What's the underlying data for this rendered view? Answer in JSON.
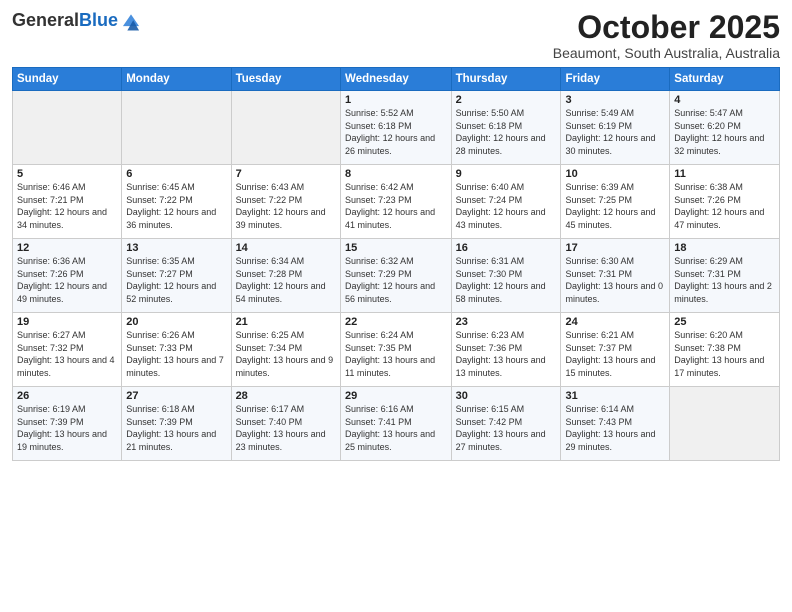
{
  "header": {
    "logo_general": "General",
    "logo_blue": "Blue",
    "month": "October 2025",
    "location": "Beaumont, South Australia, Australia"
  },
  "days_of_week": [
    "Sunday",
    "Monday",
    "Tuesday",
    "Wednesday",
    "Thursday",
    "Friday",
    "Saturday"
  ],
  "weeks": [
    [
      {
        "day": "",
        "sunrise": "",
        "sunset": "",
        "daylight": ""
      },
      {
        "day": "",
        "sunrise": "",
        "sunset": "",
        "daylight": ""
      },
      {
        "day": "",
        "sunrise": "",
        "sunset": "",
        "daylight": ""
      },
      {
        "day": "1",
        "sunrise": "Sunrise: 5:52 AM",
        "sunset": "Sunset: 6:18 PM",
        "daylight": "Daylight: 12 hours and 26 minutes."
      },
      {
        "day": "2",
        "sunrise": "Sunrise: 5:50 AM",
        "sunset": "Sunset: 6:18 PM",
        "daylight": "Daylight: 12 hours and 28 minutes."
      },
      {
        "day": "3",
        "sunrise": "Sunrise: 5:49 AM",
        "sunset": "Sunset: 6:19 PM",
        "daylight": "Daylight: 12 hours and 30 minutes."
      },
      {
        "day": "4",
        "sunrise": "Sunrise: 5:47 AM",
        "sunset": "Sunset: 6:20 PM",
        "daylight": "Daylight: 12 hours and 32 minutes."
      }
    ],
    [
      {
        "day": "5",
        "sunrise": "Sunrise: 6:46 AM",
        "sunset": "Sunset: 7:21 PM",
        "daylight": "Daylight: 12 hours and 34 minutes."
      },
      {
        "day": "6",
        "sunrise": "Sunrise: 6:45 AM",
        "sunset": "Sunset: 7:22 PM",
        "daylight": "Daylight: 12 hours and 36 minutes."
      },
      {
        "day": "7",
        "sunrise": "Sunrise: 6:43 AM",
        "sunset": "Sunset: 7:22 PM",
        "daylight": "Daylight: 12 hours and 39 minutes."
      },
      {
        "day": "8",
        "sunrise": "Sunrise: 6:42 AM",
        "sunset": "Sunset: 7:23 PM",
        "daylight": "Daylight: 12 hours and 41 minutes."
      },
      {
        "day": "9",
        "sunrise": "Sunrise: 6:40 AM",
        "sunset": "Sunset: 7:24 PM",
        "daylight": "Daylight: 12 hours and 43 minutes."
      },
      {
        "day": "10",
        "sunrise": "Sunrise: 6:39 AM",
        "sunset": "Sunset: 7:25 PM",
        "daylight": "Daylight: 12 hours and 45 minutes."
      },
      {
        "day": "11",
        "sunrise": "Sunrise: 6:38 AM",
        "sunset": "Sunset: 7:26 PM",
        "daylight": "Daylight: 12 hours and 47 minutes."
      }
    ],
    [
      {
        "day": "12",
        "sunrise": "Sunrise: 6:36 AM",
        "sunset": "Sunset: 7:26 PM",
        "daylight": "Daylight: 12 hours and 49 minutes."
      },
      {
        "day": "13",
        "sunrise": "Sunrise: 6:35 AM",
        "sunset": "Sunset: 7:27 PM",
        "daylight": "Daylight: 12 hours and 52 minutes."
      },
      {
        "day": "14",
        "sunrise": "Sunrise: 6:34 AM",
        "sunset": "Sunset: 7:28 PM",
        "daylight": "Daylight: 12 hours and 54 minutes."
      },
      {
        "day": "15",
        "sunrise": "Sunrise: 6:32 AM",
        "sunset": "Sunset: 7:29 PM",
        "daylight": "Daylight: 12 hours and 56 minutes."
      },
      {
        "day": "16",
        "sunrise": "Sunrise: 6:31 AM",
        "sunset": "Sunset: 7:30 PM",
        "daylight": "Daylight: 12 hours and 58 minutes."
      },
      {
        "day": "17",
        "sunrise": "Sunrise: 6:30 AM",
        "sunset": "Sunset: 7:31 PM",
        "daylight": "Daylight: 13 hours and 0 minutes."
      },
      {
        "day": "18",
        "sunrise": "Sunrise: 6:29 AM",
        "sunset": "Sunset: 7:31 PM",
        "daylight": "Daylight: 13 hours and 2 minutes."
      }
    ],
    [
      {
        "day": "19",
        "sunrise": "Sunrise: 6:27 AM",
        "sunset": "Sunset: 7:32 PM",
        "daylight": "Daylight: 13 hours and 4 minutes."
      },
      {
        "day": "20",
        "sunrise": "Sunrise: 6:26 AM",
        "sunset": "Sunset: 7:33 PM",
        "daylight": "Daylight: 13 hours and 7 minutes."
      },
      {
        "day": "21",
        "sunrise": "Sunrise: 6:25 AM",
        "sunset": "Sunset: 7:34 PM",
        "daylight": "Daylight: 13 hours and 9 minutes."
      },
      {
        "day": "22",
        "sunrise": "Sunrise: 6:24 AM",
        "sunset": "Sunset: 7:35 PM",
        "daylight": "Daylight: 13 hours and 11 minutes."
      },
      {
        "day": "23",
        "sunrise": "Sunrise: 6:23 AM",
        "sunset": "Sunset: 7:36 PM",
        "daylight": "Daylight: 13 hours and 13 minutes."
      },
      {
        "day": "24",
        "sunrise": "Sunrise: 6:21 AM",
        "sunset": "Sunset: 7:37 PM",
        "daylight": "Daylight: 13 hours and 15 minutes."
      },
      {
        "day": "25",
        "sunrise": "Sunrise: 6:20 AM",
        "sunset": "Sunset: 7:38 PM",
        "daylight": "Daylight: 13 hours and 17 minutes."
      }
    ],
    [
      {
        "day": "26",
        "sunrise": "Sunrise: 6:19 AM",
        "sunset": "Sunset: 7:39 PM",
        "daylight": "Daylight: 13 hours and 19 minutes."
      },
      {
        "day": "27",
        "sunrise": "Sunrise: 6:18 AM",
        "sunset": "Sunset: 7:39 PM",
        "daylight": "Daylight: 13 hours and 21 minutes."
      },
      {
        "day": "28",
        "sunrise": "Sunrise: 6:17 AM",
        "sunset": "Sunset: 7:40 PM",
        "daylight": "Daylight: 13 hours and 23 minutes."
      },
      {
        "day": "29",
        "sunrise": "Sunrise: 6:16 AM",
        "sunset": "Sunset: 7:41 PM",
        "daylight": "Daylight: 13 hours and 25 minutes."
      },
      {
        "day": "30",
        "sunrise": "Sunrise: 6:15 AM",
        "sunset": "Sunset: 7:42 PM",
        "daylight": "Daylight: 13 hours and 27 minutes."
      },
      {
        "day": "31",
        "sunrise": "Sunrise: 6:14 AM",
        "sunset": "Sunset: 7:43 PM",
        "daylight": "Daylight: 13 hours and 29 minutes."
      },
      {
        "day": "",
        "sunrise": "",
        "sunset": "",
        "daylight": ""
      }
    ]
  ]
}
